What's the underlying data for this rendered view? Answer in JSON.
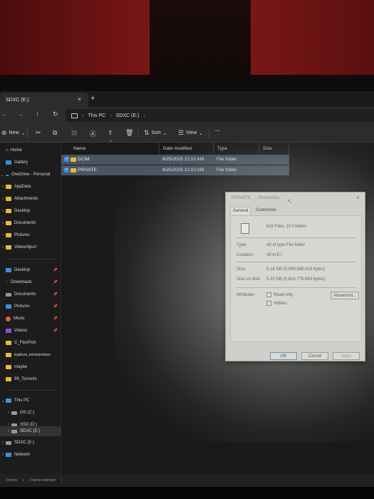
{
  "window": {
    "tab_title": "SDXC (E:)",
    "tab_close": "×",
    "new_tab": "+"
  },
  "address": {
    "back": "←",
    "forward": "→",
    "up": "↑",
    "refresh": "↻",
    "breadcrumb": [
      "This PC",
      "SDXC (E:)"
    ],
    "sep": "›"
  },
  "toolbar": {
    "new_label": "New",
    "sort_label": "Sort",
    "view_label": "View",
    "more_label": "···",
    "chevron": "⌄"
  },
  "sidebar": {
    "home": "Home",
    "gallery": "Gallery",
    "onedrive": "OneDrive - Personal",
    "od_items": [
      "AppData",
      "Attachments",
      "Desktop",
      "Documents",
      "Pictures",
      "Videoclipuri"
    ],
    "quick": [
      "Desktop",
      "Downloads",
      "Documents",
      "Pictures",
      "Music",
      "Videos",
      "C_FlexPish",
      "legătura_reinterpretare",
      "maybe",
      "99_Torrents"
    ],
    "thispc": "This PC",
    "drives": [
      "OS (C:)",
      "SSD (D:)",
      "SDXC (E:)"
    ],
    "sdxc2": "SDXC (E:)",
    "network": "Network"
  },
  "content": {
    "columns": [
      "Name",
      "Date modified",
      "Type",
      "Size"
    ],
    "rows": [
      {
        "name": "DCIM",
        "date": "6/25/2025 12:10 AM",
        "type": "File folder",
        "size": ""
      },
      {
        "name": "PRIVATE",
        "date": "6/25/2025 12:10 AM",
        "type": "File folder",
        "size": ""
      }
    ]
  },
  "status": {
    "count": "2 items",
    "selected": "2 items selected"
  },
  "dialog": {
    "title": "PRIVATE, ... Properties",
    "close": "×",
    "tabs": [
      "General",
      "Customize"
    ],
    "summary": "619 Files, 10 Folders",
    "type_label": "Type:",
    "type_value": "All of type File folder",
    "location_label": "Location:",
    "location_value": "All in E:\\",
    "size_label": "Size:",
    "size_value": "5.18 GB (5,569,588,418 bytes)",
    "disk_label": "Size on disk:",
    "disk_value": "5.22 GB (5,615,779,840 bytes)",
    "attr_label": "Attributes",
    "readonly": "Read-only",
    "hidden": "Hidden",
    "advanced": "Advanced...",
    "ok": "OK",
    "cancel": "Cancel",
    "apply": "Apply"
  }
}
